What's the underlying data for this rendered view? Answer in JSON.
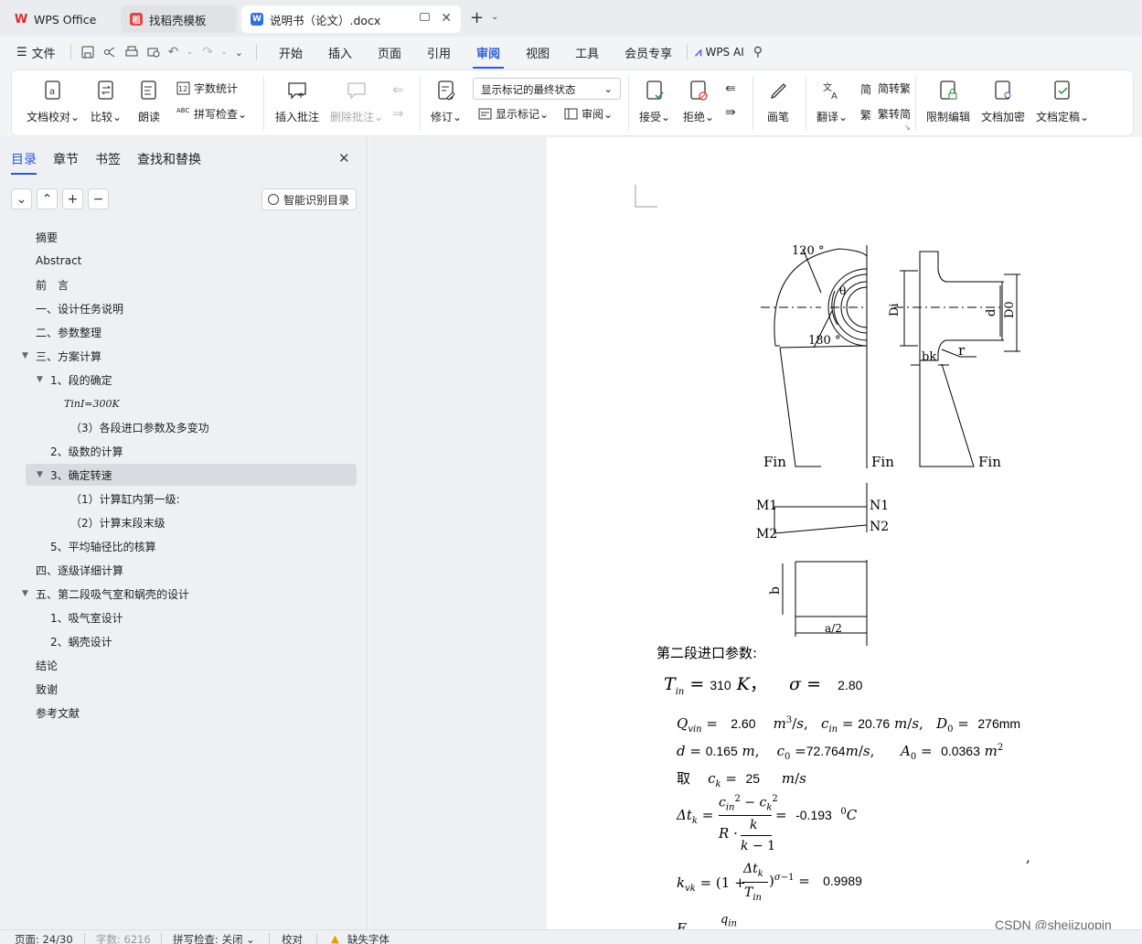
{
  "tabs": [
    {
      "label": "WPS Office"
    },
    {
      "label": "找稻壳模板"
    },
    {
      "label": "说明书（论文）.docx"
    }
  ],
  "menubar": {
    "file": "文件",
    "items": [
      "开始",
      "插入",
      "页面",
      "引用",
      "审阅",
      "视图",
      "工具",
      "会员专享"
    ],
    "active": "审阅",
    "wps_ai": "WPS AI"
  },
  "ribbon": {
    "doc_check": "文档校对",
    "compare": "比较",
    "read_aloud": "朗读",
    "word_count": "字数统计",
    "spell_check": "拼写检查",
    "insert_comment": "插入批注",
    "delete_comment": "删除批注",
    "revise": "修订",
    "markup_state": "显示标记的最终状态",
    "show_markup": "显示标记",
    "review": "审阅",
    "accept": "接受",
    "reject": "拒绝",
    "pen": "画笔",
    "translate": "翻译",
    "to_trad": "简转繁",
    "to_simp": "繁转简",
    "restrict_edit": "限制编辑",
    "encrypt": "文档加密",
    "finalize": "文档定稿"
  },
  "sidebar": {
    "tabs": [
      "目录",
      "章节",
      "书签",
      "查找和替换"
    ],
    "smart_toc": "智能识别目录",
    "items": [
      {
        "label": "摘要"
      },
      {
        "label": "Abstract"
      },
      {
        "label": "前　言"
      },
      {
        "label": "一、设计任务说明"
      },
      {
        "label": "二、参数整理"
      },
      {
        "label": "三、方案计算"
      },
      {
        "label": "1、段的确定"
      },
      {
        "label": "TinI=300K"
      },
      {
        "label": "（3）各段进口参数及多变功"
      },
      {
        "label": "2、级数的计算"
      },
      {
        "label": "3、确定转速"
      },
      {
        "label": "（1）计算缸内第一级:"
      },
      {
        "label": "（2）计算末段末级"
      },
      {
        "label": "5、平均轴径比的核算"
      },
      {
        "label": "四、逐级详细计算"
      },
      {
        "label": "五、第二段吸气室和蜗壳的设计"
      },
      {
        "label": "1、吸气室设计"
      },
      {
        "label": "2、蜗壳设计"
      },
      {
        "label": "结论"
      },
      {
        "label": "致谢"
      },
      {
        "label": "参考文献"
      }
    ]
  },
  "drawing": {
    "angle120": "120 °",
    "angle180": "180 °",
    "theta": "θ",
    "Di": "Di",
    "d": "d",
    "D0": "D0",
    "bk": "bk",
    "r": "r",
    "Fin": "Fin",
    "M1": "M1",
    "M2": "M2",
    "N1": "N1",
    "N2": "N2",
    "b": "b",
    "a2": "a/2"
  },
  "doc": {
    "heading": "第二段进口参数:",
    "Tin": "310",
    "sigma": "2.80",
    "Qvin": "2.60",
    "cin": "20.76",
    "D0": "276mm",
    "d": "0.165",
    "c0": "72.764",
    "A0": "0.0363",
    "take": "取",
    "ck": "25",
    "dtk": "-0.193",
    "kvk": "0.9989"
  },
  "status": {
    "page": "页面: 24/30",
    "words": "字数: 6216",
    "spell": "拼写检查: 关闭",
    "proof": "校对",
    "font_missing": "缺失字体"
  },
  "watermark": "CSDN @shejizuopin"
}
